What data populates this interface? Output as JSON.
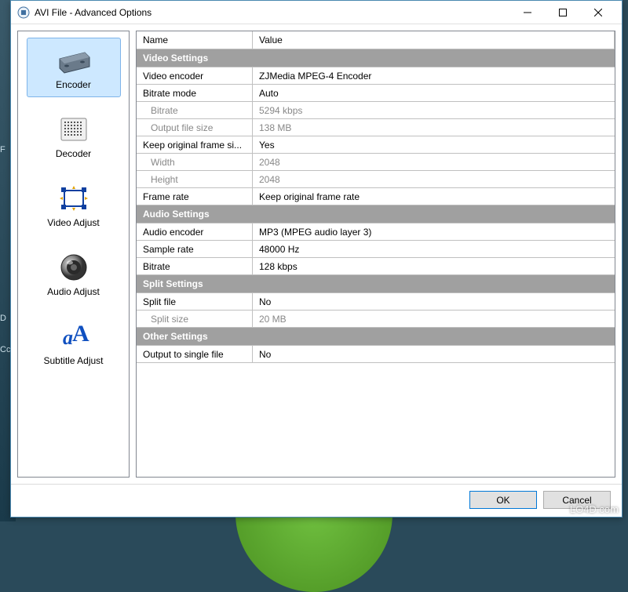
{
  "window": {
    "title": "AVI File - Advanced Options"
  },
  "sidebar": {
    "items": [
      {
        "id": "encoder",
        "label": "Encoder"
      },
      {
        "id": "decoder",
        "label": "Decoder"
      },
      {
        "id": "video-adjust",
        "label": "Video Adjust"
      },
      {
        "id": "audio-adjust",
        "label": "Audio Adjust"
      },
      {
        "id": "subtitle-adjust",
        "label": "Subtitle Adjust"
      }
    ]
  },
  "grid": {
    "header": {
      "name": "Name",
      "value": "Value"
    },
    "sections": [
      {
        "category": "Video Settings",
        "rows": [
          {
            "name": "Video encoder",
            "value": "ZJMedia MPEG-4 Encoder",
            "disabled": false,
            "indent": false
          },
          {
            "name": "Bitrate mode",
            "value": "Auto",
            "disabled": false,
            "indent": false
          },
          {
            "name": "Bitrate",
            "value": "5294 kbps",
            "disabled": true,
            "indent": true
          },
          {
            "name": "Output file size",
            "value": "138 MB",
            "disabled": true,
            "indent": true
          },
          {
            "name": "Keep original frame si...",
            "value": "Yes",
            "disabled": false,
            "indent": false
          },
          {
            "name": "Width",
            "value": "2048",
            "disabled": true,
            "indent": true
          },
          {
            "name": "Height",
            "value": "2048",
            "disabled": true,
            "indent": true
          },
          {
            "name": "Frame rate",
            "value": "Keep original frame rate",
            "disabled": false,
            "indent": false
          }
        ]
      },
      {
        "category": "Audio Settings",
        "rows": [
          {
            "name": "Audio encoder",
            "value": "MP3 (MPEG audio layer 3)",
            "disabled": false,
            "indent": false
          },
          {
            "name": "Sample rate",
            "value": "48000 Hz",
            "disabled": false,
            "indent": false
          },
          {
            "name": "Bitrate",
            "value": "128 kbps",
            "disabled": false,
            "indent": false
          }
        ]
      },
      {
        "category": "Split Settings",
        "rows": [
          {
            "name": "Split file",
            "value": "No",
            "disabled": false,
            "indent": false
          },
          {
            "name": "Split size",
            "value": "20 MB",
            "disabled": true,
            "indent": true
          }
        ]
      },
      {
        "category": "Other Settings",
        "rows": [
          {
            "name": "Output to single file",
            "value": "No",
            "disabled": false,
            "indent": false
          }
        ]
      }
    ]
  },
  "footer": {
    "ok": "OK",
    "cancel": "Cancel"
  },
  "watermark": "LO4D.com",
  "bg": {
    "f": "F",
    "d": "D",
    "cc": "Cc"
  }
}
